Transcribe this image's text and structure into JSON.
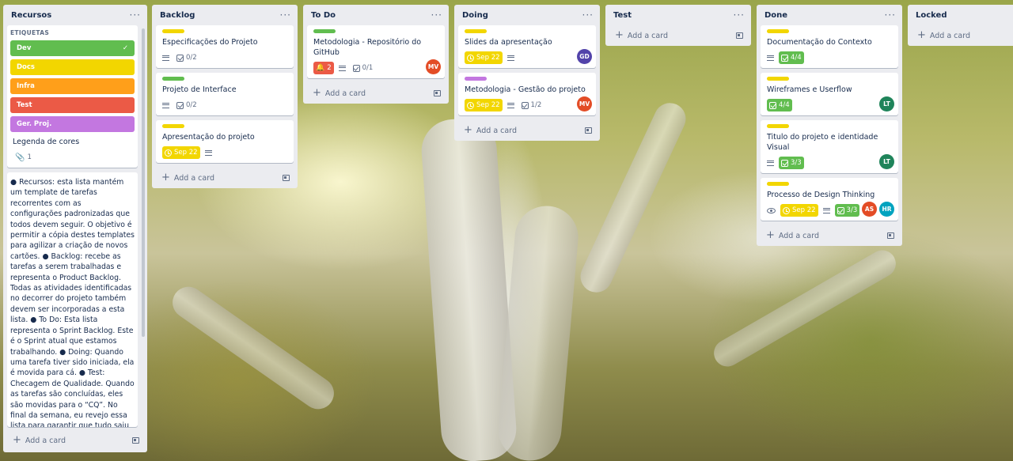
{
  "lists": {
    "recursos": {
      "title": "Recursos",
      "etiquetas_title": "ETIQUETAS",
      "labels": [
        {
          "name": "Dev",
          "color": "#61bd4f",
          "checked": true
        },
        {
          "name": "Docs",
          "color": "#f2d600"
        },
        {
          "name": "Infra",
          "color": "#ff9f1a"
        },
        {
          "name": "Test",
          "color": "#eb5a46"
        },
        {
          "name": "Ger. Proj.",
          "color": "#c377e0"
        }
      ],
      "card_title": "Legenda de cores",
      "attachments": "1",
      "description": "● Recursos: esta lista mantém um template de tarefas recorrentes com as configurações padronizadas que todos devem seguir. O objetivo é permitir a cópia destes templates para agilizar a criação de novos cartões. ● Backlog: recebe as tarefas a serem trabalhadas e representa o Product Backlog. Todas as atividades identificadas no decorrer do projeto também devem ser incorporadas a esta lista. ● To Do: Esta lista representa o Sprint Backlog. Este é o Sprint atual que estamos trabalhando. ● Doing: Quando uma tarefa tiver sido iniciada, ela é movida para cá. ● Test: Checagem de Qualidade. Quando as tarefas são concluídas, eles são movidas para o “CQ”. No final da semana, eu revejo essa lista para garantir que tudo saiu perfeito. ● Done: nesta lista são colocadas as tarefas que passaram pelos testes e",
      "add_card": "Add a card"
    },
    "backlog": {
      "title": "Backlog",
      "cards": [
        {
          "title": "Especificações do Projeto",
          "label": "#f2d600",
          "checklist": "0/2"
        },
        {
          "title": "Projeto de Interface",
          "label": "#61bd4f",
          "checklist": "0/2"
        },
        {
          "title": "Apresentação do projeto",
          "label": "#f2d600",
          "due": "Sep 22"
        }
      ],
      "add_card": "Add a card"
    },
    "todo": {
      "title": "To Do",
      "cards": [
        {
          "title": "Metodologia - Repositório do GitHub",
          "label": "#61bd4f",
          "notifications": "2",
          "checklist": "0/1",
          "member": "MV"
        }
      ],
      "add_card": "Add a card"
    },
    "doing": {
      "title": "Doing",
      "cards": [
        {
          "title": "Slides da apresentação",
          "label": "#f2d600",
          "due": "Sep 22",
          "member": "GD"
        },
        {
          "title": "Metodologia - Gestão do projeto",
          "label": "#c377e0",
          "due": "Sep 22",
          "checklist": "1/2",
          "member": "MV"
        }
      ],
      "add_card": "Add a card"
    },
    "test": {
      "title": "Test",
      "add_card": "Add a card"
    },
    "done": {
      "title": "Done",
      "cards": [
        {
          "title": "Documentação do Contexto",
          "label": "#f2d600",
          "checklist": "4/4"
        },
        {
          "title": "Wireframes e Userflow",
          "label": "#f2d600",
          "checklist": "4/4",
          "member": "LT"
        },
        {
          "title": "Titulo do projeto e identidade Visual",
          "label": "#f2d600",
          "checklist": "3/3",
          "member": "LT"
        },
        {
          "title": "Processo de Design Thinking",
          "label": "#f2d600",
          "due": "Sep 22",
          "checklist": "3/3",
          "members": [
            "AS",
            "HR"
          ]
        }
      ],
      "add_card": "Add a card"
    },
    "locked": {
      "title": "Locked",
      "add_card": "Add a card"
    }
  },
  "menu_icon": "more-horizontal-icon",
  "avatar_colors": {
    "MV": "#e34c26",
    "GD": "#5243aa",
    "LT": "#1f845a",
    "AS": "#e34c26",
    "HR": "#00a3bf"
  }
}
